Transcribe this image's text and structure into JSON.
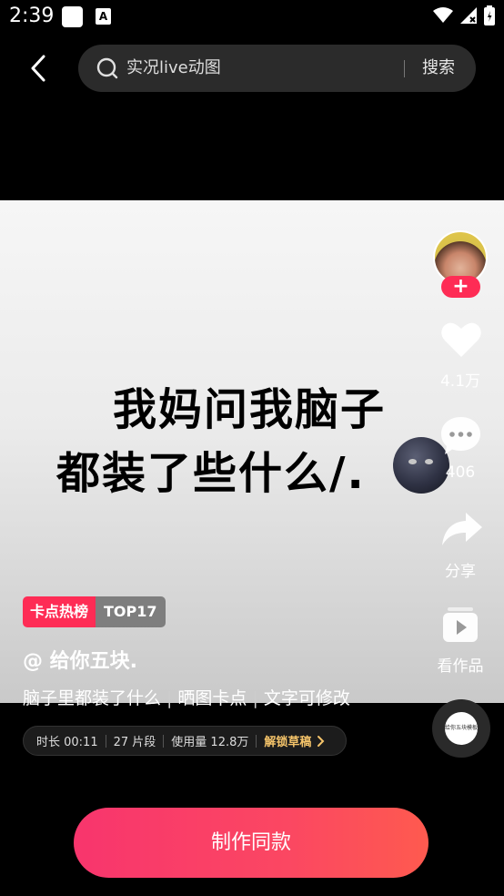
{
  "status_bar": {
    "time": "2:39",
    "a_badge": "A"
  },
  "search": {
    "query": "实况live动图",
    "button": "搜索"
  },
  "video": {
    "caption_line1": "我妈问我脑子",
    "caption_line2": "都装了些什么/."
  },
  "rail": {
    "likes": "4.1万",
    "comments": "406",
    "share": "分享",
    "works": "看作品",
    "template_thumb": "给你五块模板"
  },
  "tags": {
    "hot": "卡点热榜",
    "rank": "TOP17"
  },
  "author": "@ 给你五块.",
  "description": {
    "part1": "脑子里都装了什么",
    "part2": "晒图卡点",
    "part3": "文字可修改"
  },
  "meta": {
    "duration": "时长 00:11",
    "segments": "27 片段",
    "usage": "使用量 12.8万",
    "unlock": "解锁草稿"
  },
  "make_button": "制作同款",
  "colors": {
    "accent": "#fe2c55",
    "unlock": "#f5c46a"
  }
}
